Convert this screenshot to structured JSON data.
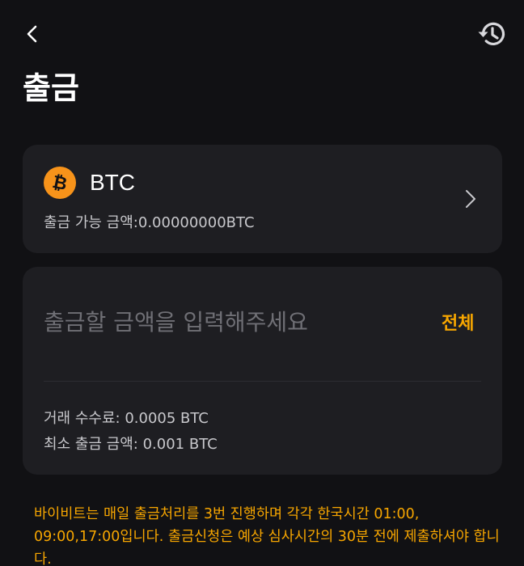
{
  "header": {
    "title": "출금"
  },
  "coin": {
    "name": "BTC",
    "available_label": "출금 가능 금액:",
    "available_value": "0.00000000BTC",
    "icon_symbol": "₿",
    "icon_color": "#f7931a"
  },
  "amount": {
    "placeholder": "출금할 금액을 입력해주세요",
    "value": "",
    "max_label": "전체"
  },
  "fees": {
    "fee_label": "거래 수수료:",
    "fee_value": " 0.0005 BTC",
    "min_label": "최소 출금 금액:",
    "min_value": " 0.001 BTC"
  },
  "notice": {
    "text": "바이비트는 매일 출금처리를 3번 진행하며 각각 한국시간 01:00, 09:00,17:00입니다. 출금신청은 예상 심사시간의 30분 전에 제출하셔야 합니다."
  },
  "colors": {
    "background": "#111114",
    "card": "#1e1e22",
    "accent": "#f7a600"
  }
}
